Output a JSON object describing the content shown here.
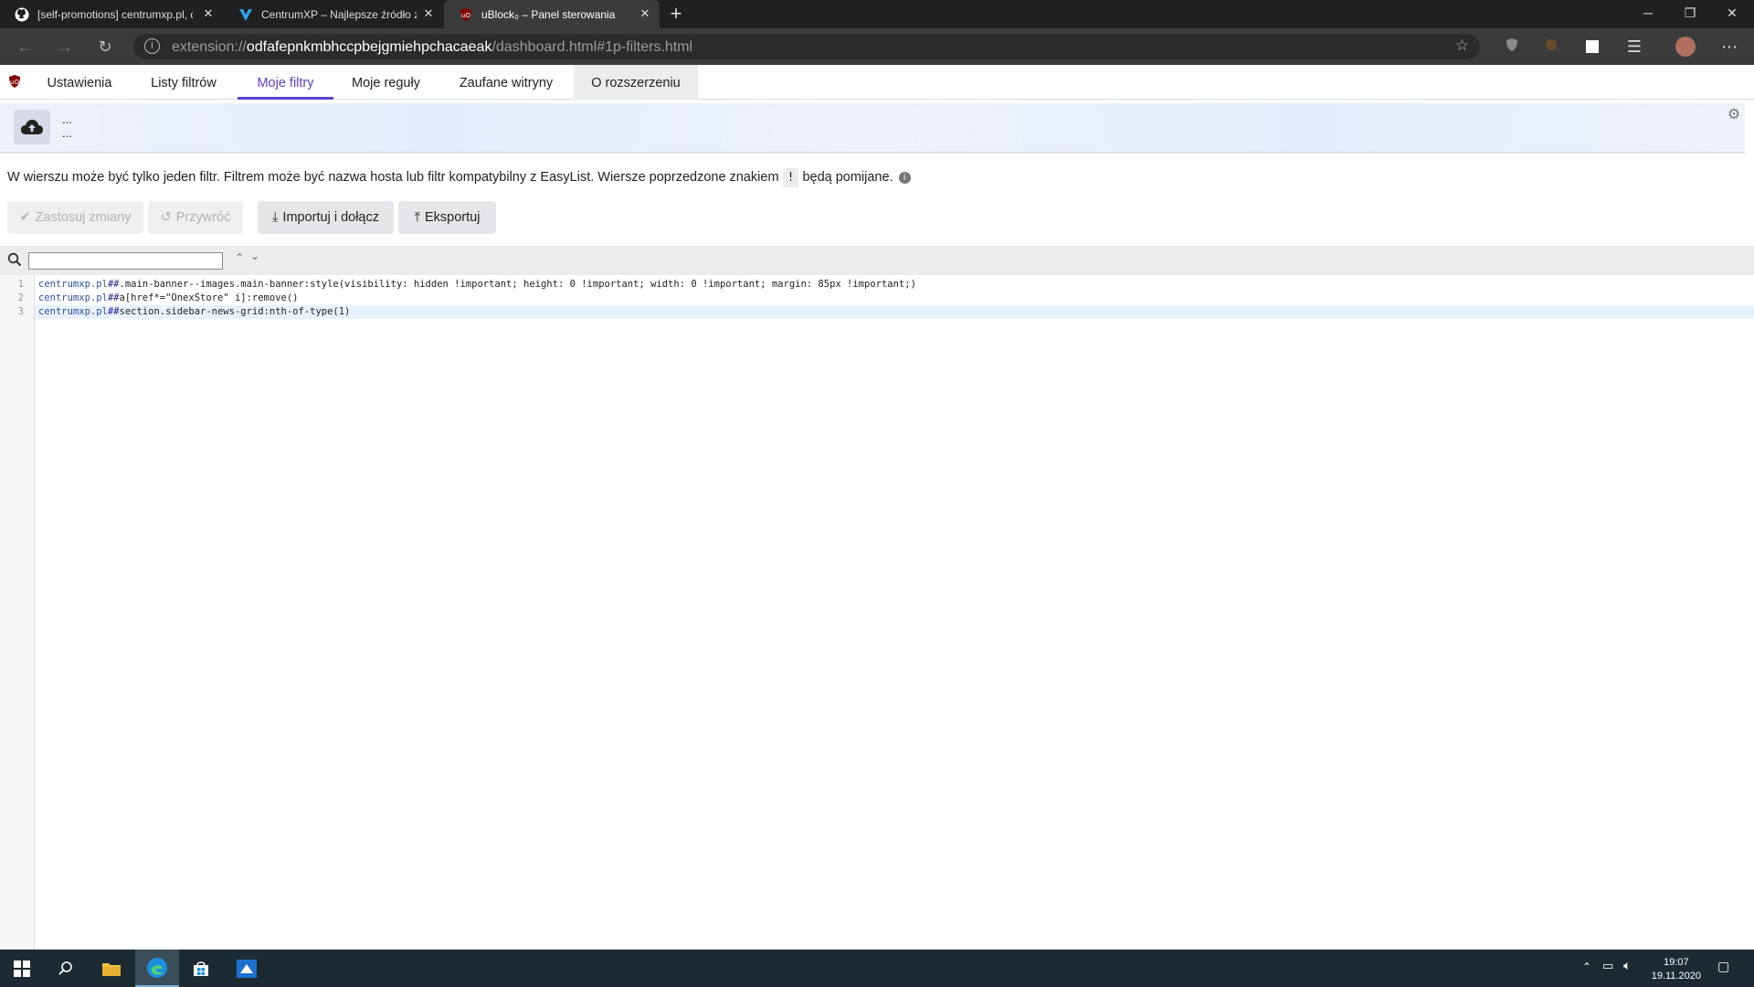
{
  "browser": {
    "tabs": [
      {
        "title": "[self-promotions] centrumxp.pl, d",
        "icon": "github-icon"
      },
      {
        "title": "CentrumXP – Najlepsze źródło ze",
        "icon": "centrumxp-icon"
      },
      {
        "title": "uBlock₀ – Panel sterowania",
        "icon": "ublock-icon"
      }
    ],
    "url_scheme": "extension://",
    "url_host": "odfafepnkmbhccpbejgmiehpchacaeak",
    "url_path": "/dashboard.html#1p-filters.html"
  },
  "ublock": {
    "tabs": [
      "Ustawienia",
      "Listy filtrów",
      "Moje filtry",
      "Moje reguły",
      "Zaufane witryny",
      "O rozszerzeniu"
    ],
    "selected_tab": "Moje filtry",
    "cloud": {
      "line1": "...",
      "line2": "..."
    },
    "notice_before": "W wierszu może być tylko jeden filtr. Filtrem może być nazwa hosta lub filtr kompatybilny z EasyList. Wiersze poprzedzone znakiem",
    "notice_char": "!",
    "notice_after": "będą pomijane.",
    "buttons": {
      "apply": "Zastosuj zmiany",
      "revert": "Przywróć",
      "import": "Importuj i dołącz",
      "export": "Eksportuj"
    },
    "search_value": "",
    "filters": [
      {
        "num": "1",
        "host": "centrumxp.pl",
        "sep": "##",
        "rest": ".main-banner--images.main-banner:style(visibility: hidden !important; height: 0 !important; width: 0 !important; margin: 85px !important;)"
      },
      {
        "num": "2",
        "host": "centrumxp.pl",
        "sep": "##",
        "rest": "a[href*=\"OnexStore\" i]:remove()"
      },
      {
        "num": "3",
        "host": "centrumxp.pl",
        "sep": "##",
        "rest": "section.sidebar-news-grid:nth-of-type(1)"
      }
    ]
  },
  "taskbar": {
    "time": "19:07",
    "date": "19.11.2020"
  },
  "colors": {
    "accent": "#5a3fd0",
    "ublock_red": "#800000"
  }
}
